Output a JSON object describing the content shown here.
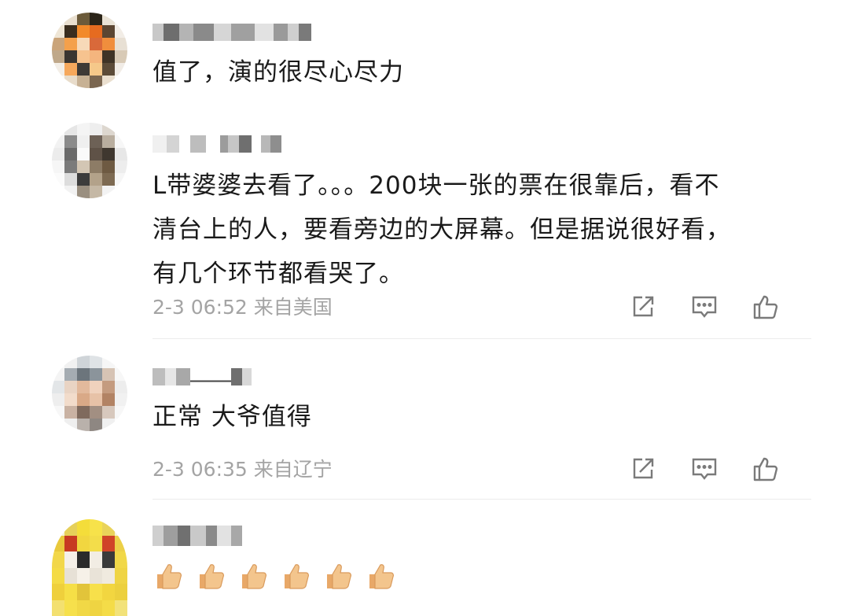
{
  "comments": [
    {
      "text": "值了，演的很尽心尽力"
    },
    {
      "text_lines": [
        "L带婆婆去看了。。。200块一张的票在很靠后，看不",
        "清台上的人，要看旁边的大屏幕。但是据说很好看，",
        "有几个环节都看哭了。"
      ],
      "timestamp": "2-3 06:52",
      "location": "来自美国"
    },
    {
      "text": "正常 大爷值得",
      "timestamp": "2-3 06:35",
      "location": "来自辽宁"
    },
    {
      "emoji_name": "thumbs-up",
      "emoji_count": 6
    }
  ],
  "actions": [
    "share-icon",
    "comment-icon",
    "like-icon"
  ],
  "colors": {
    "text": "#1a1a1a",
    "meta": "#a4a4a4",
    "icon": "#7a7a7a",
    "divider": "#ececec",
    "thumb": "#f3c58d"
  }
}
